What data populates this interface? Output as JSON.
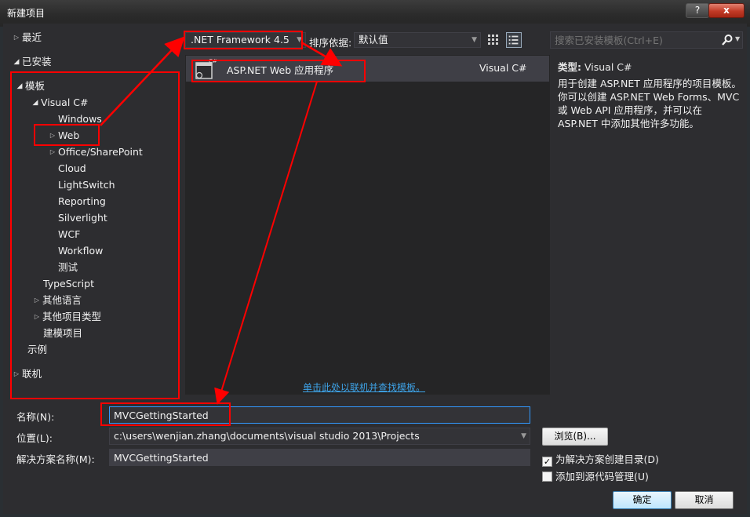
{
  "window": {
    "title": "新建项目",
    "help_glyph": "?",
    "close_glyph": "x"
  },
  "tree": {
    "recent": "最近",
    "installed": "已安装",
    "templates": "模板",
    "visual_csharp": "Visual C#",
    "children": [
      "Windows",
      "Web",
      "Office/SharePoint",
      "Cloud",
      "LightSwitch",
      "Reporting",
      "Silverlight",
      "WCF",
      "Workflow",
      "测试"
    ],
    "typescript": "TypeScript",
    "other_languages": "其他语言",
    "other_project_types": "其他项目类型",
    "modeling_projects": "建模项目",
    "samples": "示例",
    "online": "联机"
  },
  "toolbar": {
    "framework": ".NET Framework 4.5",
    "sort_label": "排序依据:",
    "sort_value": "默认值",
    "search_placeholder": "搜索已安装模板(Ctrl+E)"
  },
  "templates": [
    {
      "name": "ASP.NET Web 应用程序",
      "language": "Visual C#"
    }
  ],
  "online_link": "单击此处以联机并查找模板。",
  "details": {
    "type_label": "类型:",
    "type_value": "Visual C#",
    "description": "用于创建 ASP.NET 应用程序的项目模板。你可以创建 ASP.NET Web Forms、MVC 或 Web API 应用程序，并可以在 ASP.NET 中添加其他许多功能。"
  },
  "form": {
    "name_label": "名称(N):",
    "name_value": "MVCGettingStarted",
    "location_label": "位置(L):",
    "location_value": "c:\\users\\wenjian.zhang\\documents\\visual studio 2013\\Projects",
    "solution_label": "解决方案名称(M):",
    "solution_value": "MVCGettingStarted",
    "browse_label": "浏览(B)...",
    "create_dir_label": "为解决方案创建目录(D)",
    "create_dir_checked": true,
    "source_control_label": "添加到源代码管理(U)",
    "source_control_checked": false,
    "ok_label": "确定",
    "cancel_label": "取消"
  },
  "annotation_color": "#ff0000"
}
